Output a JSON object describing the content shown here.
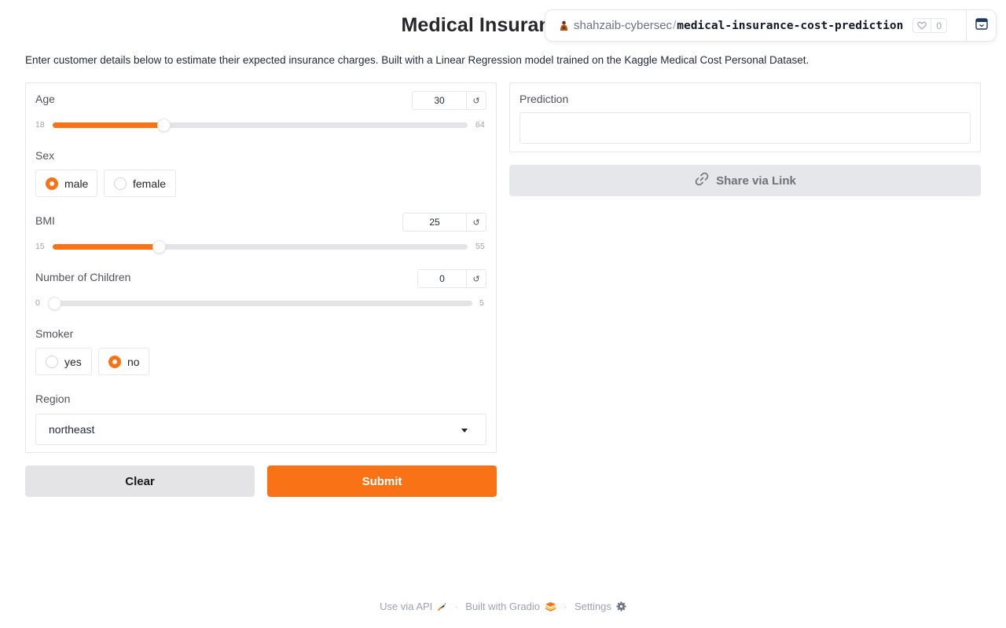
{
  "header": {
    "title": "Medical Insurance Co",
    "description": "Enter customer details below to estimate their expected insurance charges. Built with a Linear Regression model trained on the Kaggle Medical Cost Personal Dataset."
  },
  "space_badge": {
    "owner": "shahzaib-cybersec",
    "separator": "/",
    "repo": "medical-insurance-cost-prediction",
    "likes": "0",
    "icons": [
      "owner-avatar-icon",
      "heart-icon",
      "collapse-icon"
    ]
  },
  "form": {
    "age": {
      "label": "Age",
      "value": "30",
      "min": "18",
      "max": "64",
      "fraction": 0.26,
      "reset_icon": "reset-icon"
    },
    "sex": {
      "label": "Sex",
      "options": [
        "male",
        "female"
      ],
      "selected": "male"
    },
    "bmi": {
      "label": "BMI",
      "value": "25",
      "min": "15",
      "max": "55",
      "fraction": 0.25,
      "reset_icon": "reset-icon"
    },
    "children": {
      "label": "Number of Children",
      "value": "0",
      "min": "0",
      "max": "5",
      "fraction": 0.0,
      "reset_icon": "reset-icon"
    },
    "smoker": {
      "label": "Smoker",
      "options": [
        "yes",
        "no"
      ],
      "selected": "no"
    },
    "region": {
      "label": "Region",
      "value": "northeast"
    }
  },
  "output": {
    "label": "Prediction",
    "value": ""
  },
  "buttons": {
    "share": "Share via Link",
    "clear": "Clear",
    "submit": "Submit"
  },
  "footer": {
    "api": "Use via API",
    "built": "Built with Gradio",
    "settings": "Settings"
  },
  "colors": {
    "accent": "#f97316",
    "track": "#e4e4e7",
    "secondary_button": "#e4e4e7"
  }
}
